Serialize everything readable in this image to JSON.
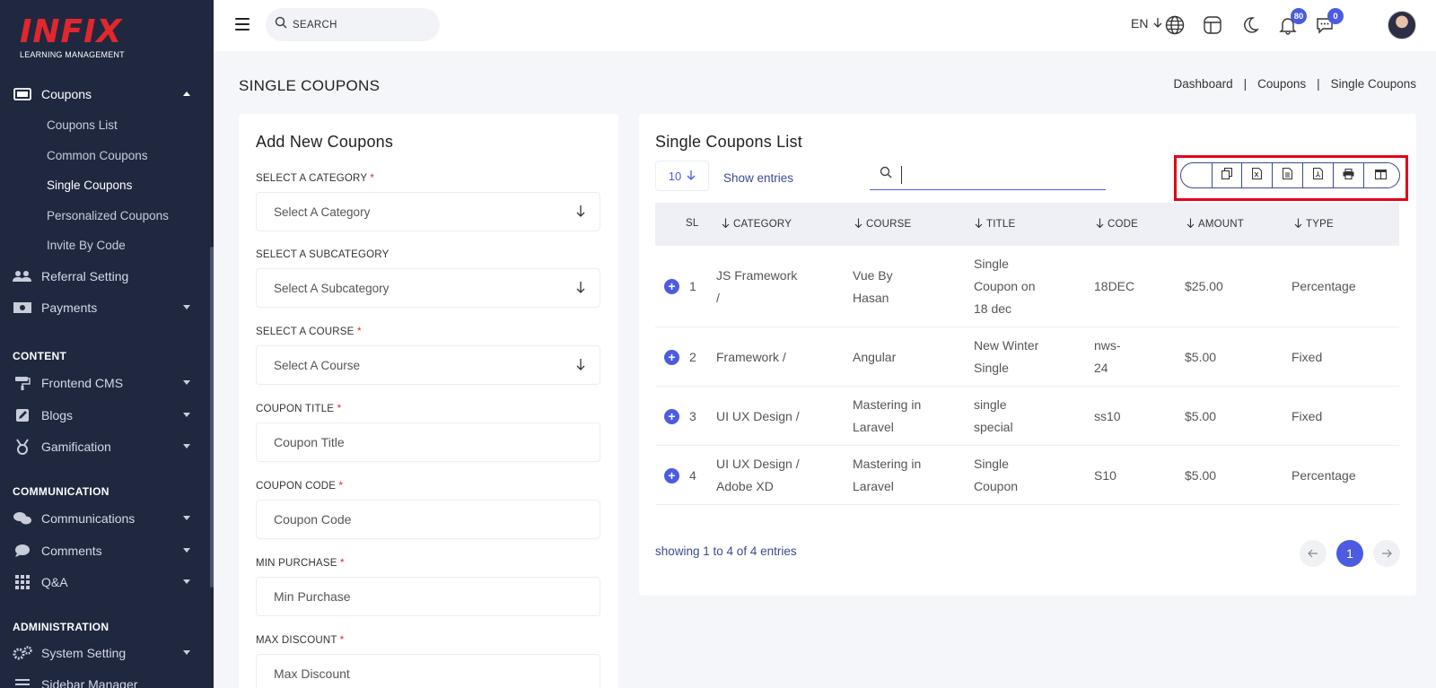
{
  "brand": {
    "name": "INFIX",
    "tagline": "LEARNING MANAGEMENT"
  },
  "sidebar": {
    "coupons": {
      "label": "Coupons",
      "icon": "ticket-icon"
    },
    "coupon_subitems": [
      "Coupons List",
      "Common Coupons",
      "Single Coupons",
      "Personalized Coupons",
      "Invite By Code"
    ],
    "referral": "Referral Setting",
    "payments": "Payments",
    "section_content": "CONTENT",
    "frontend_cms": "Frontend CMS",
    "blogs": "Blogs",
    "gamification": "Gamification",
    "section_communication": "COMMUNICATION",
    "communications": "Communications",
    "comments": "Comments",
    "qa": "Q&A",
    "section_administration": "ADMINISTRATION",
    "system_setting": "System Setting",
    "sidebar_manager": "Sidebar Manager"
  },
  "topbar": {
    "search_placeholder": "SEARCH",
    "language": "EN",
    "notifications_count": "80",
    "messages_count": "0"
  },
  "page": {
    "title": "SINGLE COUPONS",
    "breadcrumb": [
      "Dashboard",
      "Coupons",
      "Single Coupons"
    ]
  },
  "form": {
    "title": "Add New Coupons",
    "category_label": "SELECT A CATEGORY",
    "category_placeholder": "Select A Category",
    "subcategory_label": "SELECT A SUBCATEGORY",
    "subcategory_placeholder": "Select A Subcategory",
    "course_label": "SELECT A COURSE",
    "course_placeholder": "Select A Course",
    "coupon_title_label": "COUPON TITLE",
    "coupon_title_placeholder": "Coupon Title",
    "coupon_code_label": "COUPON CODE",
    "coupon_code_placeholder": "Coupon Code",
    "min_purchase_label": "MIN PURCHASE",
    "min_purchase_placeholder": "Min Purchase",
    "max_discount_label": "MAX DISCOUNT",
    "max_discount_placeholder": "Max Discount",
    "required_mark": "*"
  },
  "list": {
    "title": "Single Coupons List",
    "entries_value": "10",
    "show_entries": "Show entries",
    "columns": [
      "SL",
      "CATEGORY",
      "COURSE",
      "TITLE",
      "CODE",
      "AMOUNT",
      "TYPE"
    ],
    "rows": [
      {
        "sl": "1",
        "category": [
          "JS Framework",
          "/"
        ],
        "course": [
          "Vue By",
          "Hasan"
        ],
        "title": [
          "Single",
          "Coupon on",
          "18 dec"
        ],
        "code": [
          "18DEC"
        ],
        "amount": "$25.00",
        "type": "Percentage"
      },
      {
        "sl": "2",
        "category": [
          "Framework /"
        ],
        "course": [
          "Angular"
        ],
        "title": [
          "New Winter",
          "Single"
        ],
        "code": [
          "nws-",
          "24"
        ],
        "amount": "$5.00",
        "type": "Fixed"
      },
      {
        "sl": "3",
        "category": [
          "UI UX Design /"
        ],
        "course": [
          "Mastering in",
          "Laravel"
        ],
        "title": [
          "single",
          "special"
        ],
        "code": [
          "ss10"
        ],
        "amount": "$5.00",
        "type": "Fixed"
      },
      {
        "sl": "4",
        "category": [
          "UI UX Design /",
          "Adobe XD"
        ],
        "course": [
          "Mastering in",
          "Laravel"
        ],
        "title": [
          "Single",
          "Coupon"
        ],
        "code": [
          "S10"
        ],
        "amount": "$5.00",
        "type": "Percentage"
      }
    ],
    "showing_text": "showing 1 to 4 of 4 entries",
    "current_page": "1"
  },
  "colors": {
    "sidebar_bg": "#202840",
    "accent": "#4b5ce1",
    "brand_red": "#e1272d",
    "highlight_box": "#e3001b"
  }
}
